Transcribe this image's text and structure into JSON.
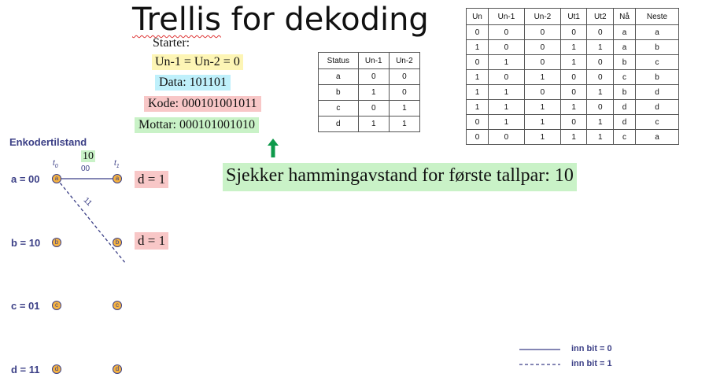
{
  "title_part1": "Trellis",
  "title_part2": " for dekoding",
  "info": {
    "starter": "Starter:",
    "init": "Un-1 = Un-2 = 0",
    "data": "Data:  101101",
    "kode": "Kode:  000101001011",
    "mottar": "Mottar:  000101001010"
  },
  "status_table": {
    "headers": [
      "Status",
      "Un-1",
      "Un-2"
    ],
    "rows": [
      [
        "a",
        "0",
        "0"
      ],
      [
        "b",
        "1",
        "0"
      ],
      [
        "c",
        "0",
        "1"
      ],
      [
        "d",
        "1",
        "1"
      ]
    ]
  },
  "transition_table": {
    "headers": [
      "Un",
      "Un-1",
      "Un-2",
      "Ut1",
      "Ut2",
      "Nå",
      "Neste"
    ],
    "rows": [
      [
        "0",
        "0",
        "0",
        "0",
        "0",
        "a",
        "a"
      ],
      [
        "1",
        "0",
        "0",
        "1",
        "1",
        "a",
        "b"
      ],
      [
        "0",
        "1",
        "0",
        "1",
        "0",
        "b",
        "c"
      ],
      [
        "1",
        "0",
        "1",
        "0",
        "0",
        "c",
        "b"
      ],
      [
        "1",
        "1",
        "0",
        "0",
        "1",
        "b",
        "d"
      ],
      [
        "1",
        "1",
        "1",
        "1",
        "0",
        "d",
        "d"
      ],
      [
        "0",
        "1",
        "1",
        "0",
        "1",
        "d",
        "c"
      ],
      [
        "0",
        "0",
        "1",
        "1",
        "1",
        "c",
        "a"
      ]
    ]
  },
  "trellis": {
    "heading": "Enkodertilstand",
    "states": [
      "a = 00",
      "b = 10",
      "c = 01",
      "d = 11"
    ],
    "node_letters": [
      "a",
      "b",
      "c",
      "d"
    ],
    "t0": "t",
    "t0_sub": "0",
    "t1": "t",
    "t1_sub": "1",
    "received_pair": "10",
    "branch_solid_label": "00",
    "branch_dashed_label": "11",
    "dist_a": "d = 1",
    "dist_b": "d = 1"
  },
  "callout": "Sjekker hammingavstand for første tallpar: 10",
  "legend": {
    "solid": "inn bit = 0",
    "dashed": "inn bit = 1"
  },
  "colors": {
    "navy": "#3b3f86",
    "node_fill": "#f5b342",
    "arrow_green": "#0e9a4b"
  }
}
